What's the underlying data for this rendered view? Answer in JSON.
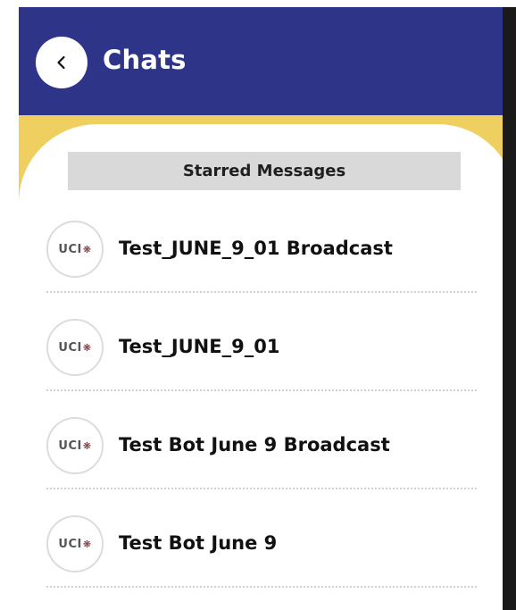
{
  "header": {
    "title": "Chats",
    "back_icon": "chevron-left-icon",
    "color": "#2e3589"
  },
  "accent_color": "#f0cf61",
  "section": {
    "title": "Starred Messages"
  },
  "chats": [
    {
      "name": "Test_JUNE_9_01 Broadcast",
      "avatar_text": "UCI",
      "avatar_icon": "paw-icon"
    },
    {
      "name": "Test_JUNE_9_01",
      "avatar_text": "UCI",
      "avatar_icon": "paw-icon"
    },
    {
      "name": "Test Bot June 9 Broadcast",
      "avatar_text": "UCI",
      "avatar_icon": "paw-icon"
    },
    {
      "name": "Test Bot June 9",
      "avatar_text": "UCI",
      "avatar_icon": "paw-icon"
    }
  ]
}
